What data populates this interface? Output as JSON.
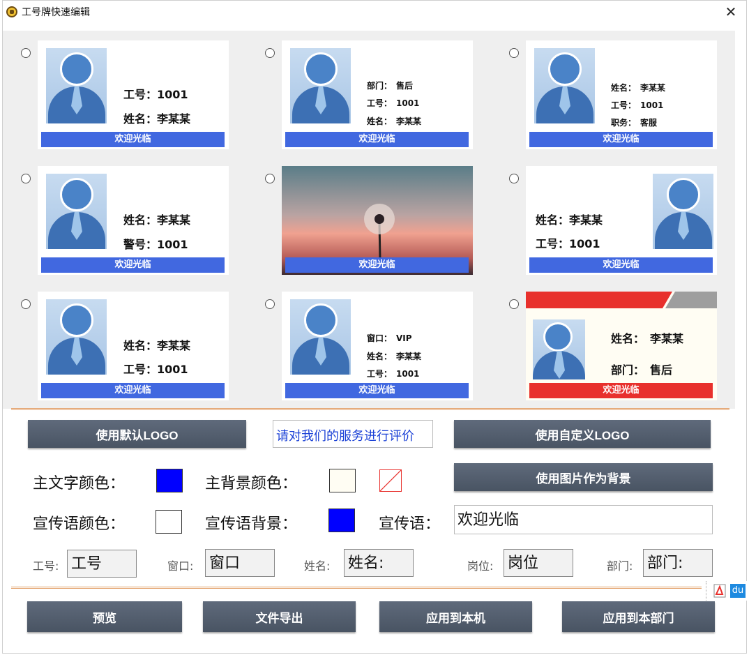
{
  "window": {
    "title": "工号牌快速编辑",
    "close": "✕"
  },
  "cards": [
    {
      "lines": [
        "工号：1001",
        "姓名：李某某"
      ],
      "slogan": "欢迎光临"
    },
    {
      "lines": [
        "部门：　售后",
        "工号：　1001",
        "姓名：　李某某"
      ],
      "slogan": "欢迎光临"
    },
    {
      "lines": [
        "姓名：　李某某",
        "工号：　1001",
        "职务：　客服"
      ],
      "slogan": "欢迎光临"
    },
    {
      "lines": [
        "姓名：李某某",
        "警号：1001"
      ],
      "slogan": "欢迎光临"
    },
    {
      "lines": [],
      "slogan": "欢迎光临"
    },
    {
      "lines": [
        "姓名：李某某",
        "工号：1001"
      ],
      "slogan": "欢迎光临"
    },
    {
      "lines": [
        "姓名：李某某",
        "工号：1001"
      ],
      "slogan": "欢迎光临"
    },
    {
      "lines": [
        "窗口：　VIP",
        "姓名：　李某某",
        "工号：　1001"
      ],
      "slogan": "欢迎光临"
    },
    {
      "lines": [
        "姓名：　李某某",
        "部门：　售后"
      ],
      "slogan": "欢迎光临"
    }
  ],
  "controls": {
    "default_logo": "使用默认LOGO",
    "rate_link": "请对我们的服务进行评价",
    "custom_logo": "使用自定义LOGO",
    "main_text_color": "主文字颜色：",
    "main_bg_color": "主背景颜色：",
    "image_bg": "使用图片作为背景",
    "slogan_color": "宣传语颜色：",
    "slogan_bg": "宣传语背景：",
    "slogan": "宣传语：",
    "slogan_value": "欢迎光临"
  },
  "colors": {
    "main_text": "#0000ff",
    "main_bg": "#fffdf3",
    "slogan_text": "#ffffff",
    "slogan_bg": "#0000ff",
    "band": "#4168e0",
    "red": "#e8302c"
  },
  "fields": [
    {
      "label": "工号:",
      "value": "工号"
    },
    {
      "label": "窗口:",
      "value": "窗口"
    },
    {
      "label": "姓名:",
      "value": "姓名:"
    },
    {
      "label": "岗位:",
      "value": "岗位"
    },
    {
      "label": "部门:",
      "value": "部门:"
    }
  ],
  "buttons": {
    "preview": "预览",
    "export": "文件导出",
    "apply_local": "应用到本机",
    "apply_dept": "应用到本部门"
  },
  "tray": {
    "du": "du"
  }
}
